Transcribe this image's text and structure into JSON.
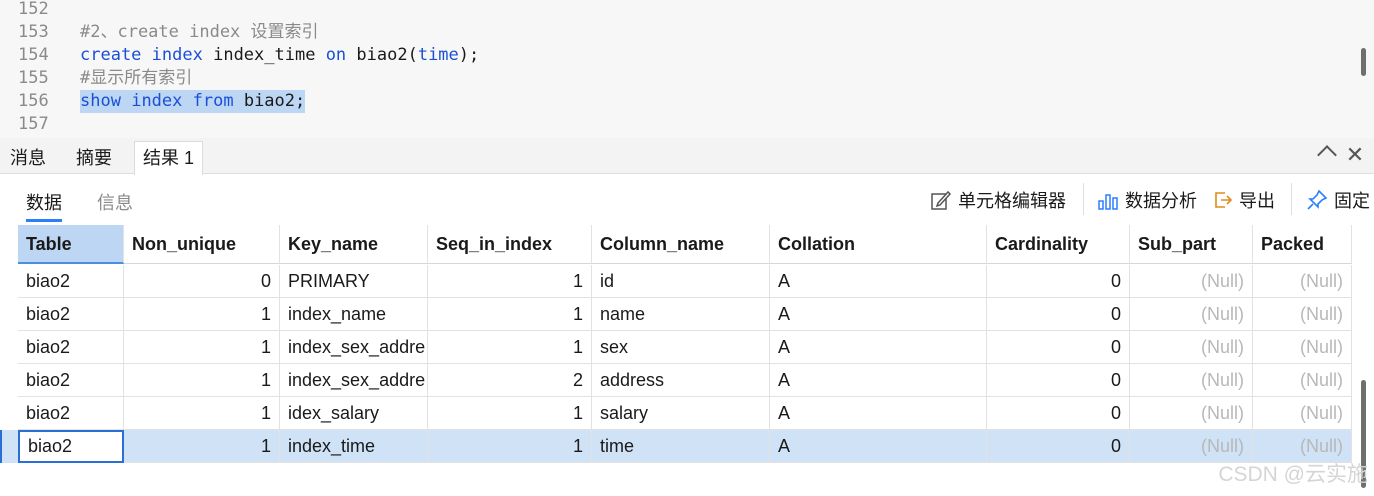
{
  "editor": {
    "lines": [
      {
        "num": "152",
        "parts": []
      },
      {
        "num": "153",
        "parts": [
          {
            "t": "#2、create index 设置索引",
            "c": "cmt"
          }
        ]
      },
      {
        "num": "154",
        "parts": [
          {
            "t": "create",
            "c": "kw"
          },
          {
            "t": " ",
            "c": "plain"
          },
          {
            "t": "index",
            "c": "kw"
          },
          {
            "t": " index_time ",
            "c": "plain"
          },
          {
            "t": "on",
            "c": "kw"
          },
          {
            "t": " biao2(",
            "c": "plain"
          },
          {
            "t": "time",
            "c": "kw"
          },
          {
            "t": ");",
            "c": "plain"
          }
        ]
      },
      {
        "num": "155",
        "parts": [
          {
            "t": "#显示所有索引",
            "c": "cmt"
          }
        ]
      },
      {
        "num": "156",
        "selected": true,
        "parts": [
          {
            "t": "show",
            "c": "kw"
          },
          {
            "t": " ",
            "c": "plain"
          },
          {
            "t": "index",
            "c": "kw"
          },
          {
            "t": " ",
            "c": "plain"
          },
          {
            "t": "from",
            "c": "kw"
          },
          {
            "t": " biao2;",
            "c": "plain"
          }
        ]
      },
      {
        "num": "157",
        "parts": []
      }
    ]
  },
  "result_tabs": {
    "messages": "消息",
    "summary": "摘要",
    "result1": "结果 1"
  },
  "sub_tabs": {
    "data": "数据",
    "info": "信息"
  },
  "toolbar": {
    "cell_editor": "单元格编辑器",
    "data_analysis": "数据分析",
    "export": "导出",
    "pin": "固定"
  },
  "grid": {
    "columns": [
      "Table",
      "Non_unique",
      "Key_name",
      "Seq_in_index",
      "Column_name",
      "Collation",
      "Cardinality",
      "Sub_part",
      "Packed"
    ],
    "rows": [
      [
        "biao2",
        "0",
        "PRIMARY",
        "1",
        "id",
        "A",
        "0",
        "(Null)",
        "(Null)"
      ],
      [
        "biao2",
        "1",
        "index_name",
        "1",
        "name",
        "A",
        "0",
        "(Null)",
        "(Null)"
      ],
      [
        "biao2",
        "1",
        "index_sex_addre",
        "1",
        "sex",
        "A",
        "0",
        "(Null)",
        "(Null)"
      ],
      [
        "biao2",
        "1",
        "index_sex_addre",
        "2",
        "address",
        "A",
        "0",
        "(Null)",
        "(Null)"
      ],
      [
        "biao2",
        "1",
        "idex_salary",
        "1",
        "salary",
        "A",
        "0",
        "(Null)",
        "(Null)"
      ],
      [
        "biao2",
        "1",
        "index_time",
        "1",
        "time",
        "A",
        "0",
        "(Null)",
        "(Null)"
      ]
    ],
    "selected_row": 5,
    "editing_value": "biao2"
  },
  "watermark": "CSDN @云实施",
  "colors": {
    "keyword": "#1a4fd6",
    "selection": "#bcd6f3",
    "row_selected": "#cfe2f6",
    "accent": "#2a7fff"
  }
}
